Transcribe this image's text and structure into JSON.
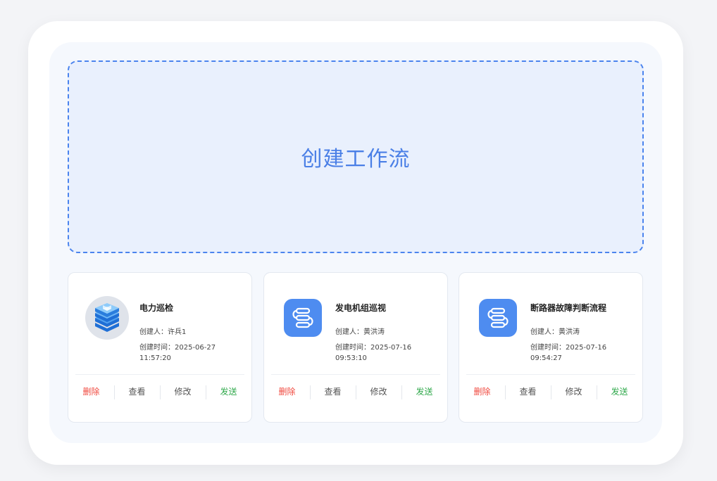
{
  "create_button": {
    "label": "创建工作流"
  },
  "workflows": [
    {
      "title": "电力巡检",
      "creator_label": "创建人：",
      "creator": "许兵1",
      "time_label": "创建时间：",
      "time": "2025-06-27 11:57:20",
      "icon": "server-stack-icon"
    },
    {
      "title": "发电机组巡视",
      "creator_label": "创建人：",
      "creator": "黄洪涛",
      "time_label": "创建时间：",
      "time": "2025-07-16 09:53:10",
      "icon": "workflow-app-icon"
    },
    {
      "title": "断路器故障判断流程",
      "creator_label": "创建人：",
      "creator": "黄洪涛",
      "time_label": "创建时间：",
      "time": "2025-07-16 09:54:27",
      "icon": "workflow-app-icon"
    }
  ],
  "actions": {
    "delete": "删除",
    "view": "查看",
    "edit": "修改",
    "send": "发送"
  },
  "colors": {
    "accent": "#4a7fe6",
    "delete": "#f0483e",
    "send": "#2ea84a",
    "app_icon_bg": "#4e8cf0"
  }
}
